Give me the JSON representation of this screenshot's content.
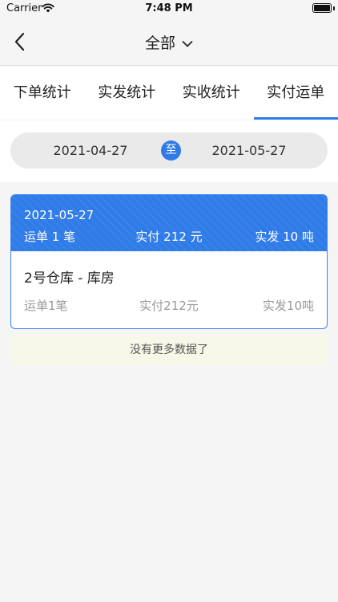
{
  "status_bar": {
    "carrier": "Carrier",
    "time": "7:48 PM"
  },
  "nav": {
    "title": "全部",
    "back_icon": "chevron-left-icon",
    "dropdown_icon": "chevron-down-icon"
  },
  "tabs": [
    {
      "label": "下单统计",
      "active": false
    },
    {
      "label": "实发统计",
      "active": false
    },
    {
      "label": "实收统计",
      "active": false
    },
    {
      "label": "实付运单",
      "active": true
    }
  ],
  "date_range": {
    "start": "2021-04-27",
    "separator": "至",
    "end": "2021-05-27"
  },
  "records": [
    {
      "date": "2021-05-27",
      "summary": {
        "orders": "运单 1 笔",
        "paid": "实付 212 元",
        "shipped": "实发 10 吨"
      },
      "warehouse": "2号仓库 - 库房",
      "detail": {
        "orders": "运单1笔",
        "paid": "实付212元",
        "shipped": "实发10吨"
      }
    }
  ],
  "footer": {
    "no_more": "没有更多数据了"
  },
  "colors": {
    "accent": "#2f7be8",
    "background": "#f5f5f5",
    "no_more_bg": "#f8f8e8"
  }
}
